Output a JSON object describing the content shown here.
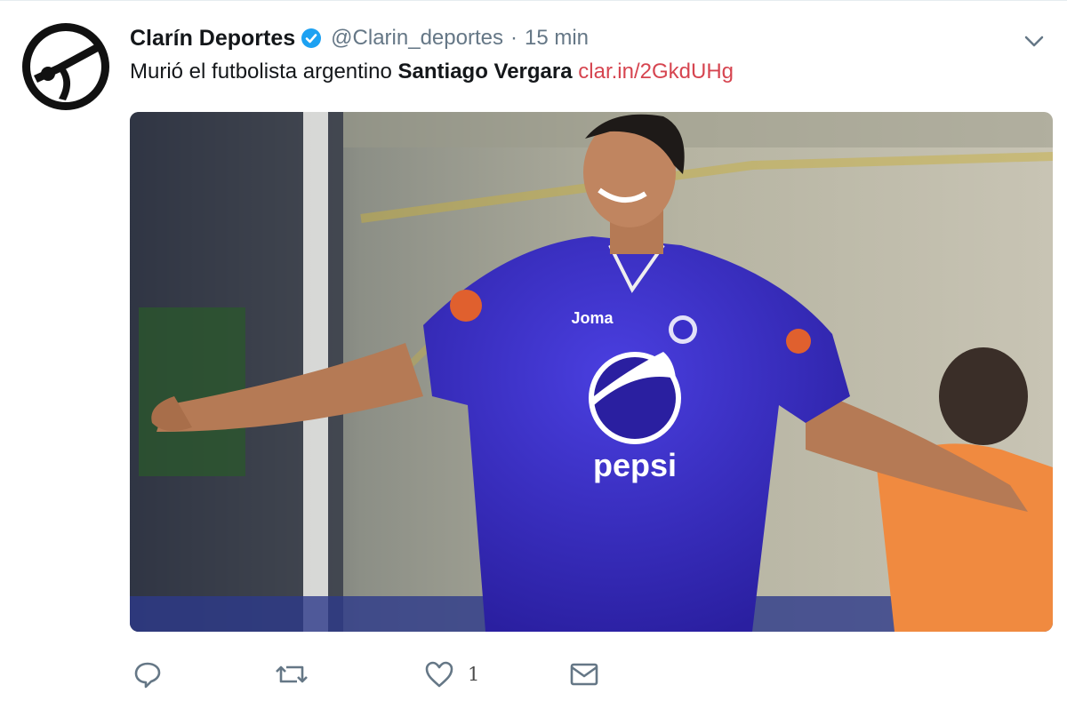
{
  "tweet": {
    "display_name": "Clarín Deportes",
    "handle": "@Clarin_deportes",
    "separator": "·",
    "time": "15 min",
    "text_prefix": "Murió el futbolista argentino",
    "text_bold": "Santiago Vergara",
    "link": "clar.in/2GkdUHg"
  },
  "media": {
    "jersey_sponsor": "pepsi",
    "jersey_brand": "Joma"
  },
  "actions": {
    "reply": "reply-icon",
    "retweet": "retweet-icon",
    "like": "heart-icon",
    "like_count": "1",
    "message": "envelope-icon"
  },
  "colors": {
    "link": "#d64550",
    "verified": "#1da1f2",
    "meta": "#657786",
    "jersey": "#3a2fc9"
  }
}
